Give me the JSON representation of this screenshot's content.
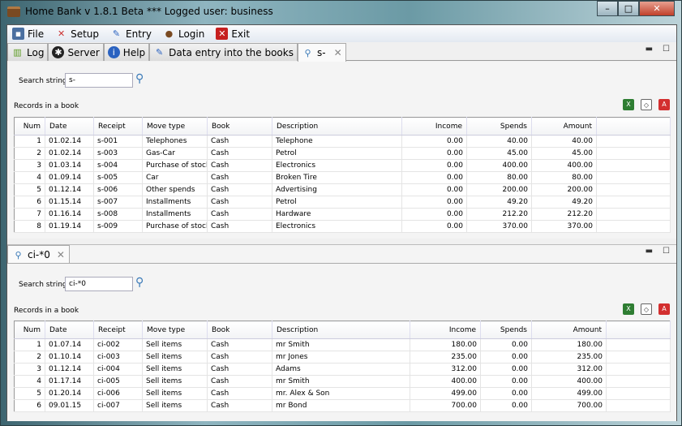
{
  "window": {
    "title": "Home Bank v 1.8.1 Beta  *** Logged user: business",
    "min": "–",
    "max": "□",
    "close": "✕"
  },
  "menu": [
    {
      "label": "File",
      "icon": "floppy-icon"
    },
    {
      "label": "Setup",
      "icon": "tools-icon"
    },
    {
      "label": "Entry",
      "icon": "pencil-icon"
    },
    {
      "label": "Login",
      "icon": "user-icon"
    },
    {
      "label": "Exit",
      "icon": "exit-icon"
    }
  ],
  "tabs": [
    {
      "label": "Log"
    },
    {
      "label": "Server"
    },
    {
      "label": "Help"
    },
    {
      "label": "Data entry into the books"
    },
    {
      "label": "s-"
    }
  ],
  "columns": [
    "Num",
    "Date",
    "Receipt",
    "Move type",
    "Book",
    "Description",
    "Income",
    "Spends",
    "Amount"
  ],
  "panel1": {
    "search_label": "Search string",
    "search_value": "s-",
    "records_label": "Records in a book",
    "rows": [
      [
        "1",
        "01.02.14",
        "s-001",
        "Telephones",
        "Cash",
        "Telephone",
        "0.00",
        "40.00",
        "40.00"
      ],
      [
        "2",
        "01.02.14",
        "s-003",
        "Gas-Car",
        "Cash",
        "Petrol",
        "0.00",
        "45.00",
        "45.00"
      ],
      [
        "3",
        "01.03.14",
        "s-004",
        "Purchase of stock",
        "Cash",
        "Electronics",
        "0.00",
        "400.00",
        "400.00"
      ],
      [
        "4",
        "01.09.14",
        "s-005",
        "Car",
        "Cash",
        "Broken Tire",
        "0.00",
        "80.00",
        "80.00"
      ],
      [
        "5",
        "01.12.14",
        "s-006",
        "Other spends",
        "Cash",
        "Advertising",
        "0.00",
        "200.00",
        "200.00"
      ],
      [
        "6",
        "01.15.14",
        "s-007",
        "Installments",
        "Cash",
        "Petrol",
        "0.00",
        "49.20",
        "49.20"
      ],
      [
        "7",
        "01.16.14",
        "s-008",
        "Installments",
        "Cash",
        "Hardware",
        "0.00",
        "212.20",
        "212.20"
      ],
      [
        "8",
        "01.19.14",
        "s-009",
        "Purchase of stock",
        "Cash",
        "Electronics",
        "0.00",
        "370.00",
        "370.00"
      ]
    ]
  },
  "panel2": {
    "tab_label": "ci-*0",
    "search_label": "Search string",
    "search_value": "ci-*0",
    "records_label": "Records in a book",
    "rows": [
      [
        "1",
        "01.07.14",
        "ci-002",
        "Sell items",
        "Cash",
        "mr Smith",
        "180.00",
        "0.00",
        "180.00"
      ],
      [
        "2",
        "01.10.14",
        "ci-003",
        "Sell items",
        "Cash",
        "mr Jones",
        "235.00",
        "0.00",
        "235.00"
      ],
      [
        "3",
        "01.12.14",
        "ci-004",
        "Sell items",
        "Cash",
        "Adams",
        "312.00",
        "0.00",
        "312.00"
      ],
      [
        "4",
        "01.17.14",
        "ci-005",
        "Sell items",
        "Cash",
        "mr Smith",
        "400.00",
        "0.00",
        "400.00"
      ],
      [
        "5",
        "01.20.14",
        "ci-006",
        "Sell items",
        "Cash",
        "mr. Alex & Son",
        "499.00",
        "0.00",
        "499.00"
      ],
      [
        "6",
        "09.01.15",
        "ci-007",
        "Sell items",
        "Cash",
        "mr Bond",
        "700.00",
        "0.00",
        "700.00"
      ]
    ]
  },
  "colors": {
    "excel": "#2e7d32",
    "pdf": "#d32f2f"
  }
}
